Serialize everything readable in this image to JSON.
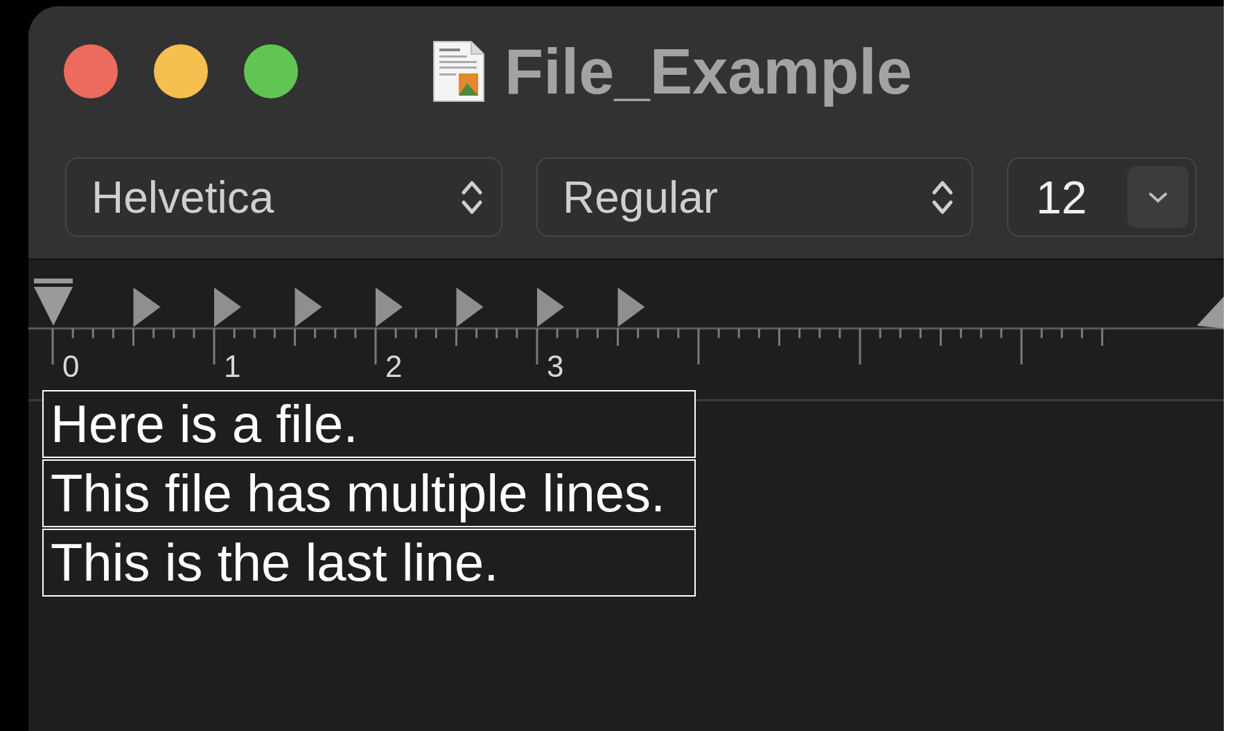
{
  "window": {
    "title": "File_Example"
  },
  "toolbar": {
    "font": "Helvetica",
    "style": "Regular",
    "size": "12"
  },
  "ruler": {
    "labels": [
      "0",
      "1",
      "2",
      "3"
    ]
  },
  "document": {
    "lines": [
      "Here is a file.",
      "This file has multiple lines.",
      "This is the last line."
    ]
  }
}
